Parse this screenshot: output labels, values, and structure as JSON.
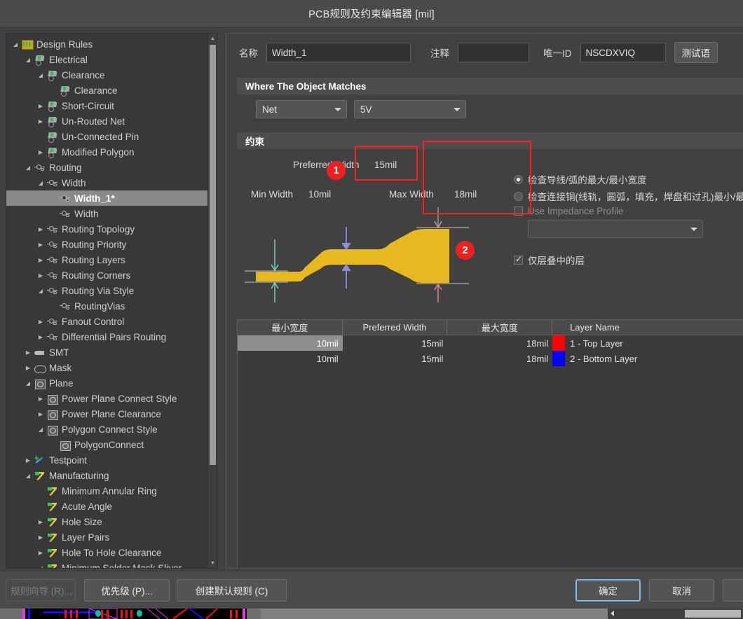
{
  "window": {
    "title": "PCB规则及约束编辑器 [mil]"
  },
  "sidebar": {
    "items": [
      {
        "label": "Design Rules",
        "depth": 0,
        "arrow": "expanded",
        "icon": "folder"
      },
      {
        "label": "Electrical",
        "depth": 1,
        "arrow": "expanded",
        "icon": "elec"
      },
      {
        "label": "Clearance",
        "depth": 2,
        "arrow": "expanded",
        "icon": "elec"
      },
      {
        "label": "Clearance",
        "depth": 3,
        "arrow": "none",
        "icon": "elec"
      },
      {
        "label": "Short-Circuit",
        "depth": 2,
        "arrow": "collapsed",
        "icon": "elec"
      },
      {
        "label": "Un-Routed Net",
        "depth": 2,
        "arrow": "collapsed",
        "icon": "elec"
      },
      {
        "label": "Un-Connected Pin",
        "depth": 2,
        "arrow": "none",
        "icon": "elec"
      },
      {
        "label": "Modified Polygon",
        "depth": 2,
        "arrow": "collapsed",
        "icon": "elec"
      },
      {
        "label": "Routing",
        "depth": 1,
        "arrow": "expanded",
        "icon": "route"
      },
      {
        "label": "Width",
        "depth": 2,
        "arrow": "expanded",
        "icon": "route"
      },
      {
        "label": "Width_1*",
        "depth": 3,
        "arrow": "none",
        "icon": "route",
        "selected": true
      },
      {
        "label": "Width",
        "depth": 3,
        "arrow": "none",
        "icon": "route"
      },
      {
        "label": "Routing Topology",
        "depth": 2,
        "arrow": "collapsed",
        "icon": "route"
      },
      {
        "label": "Routing Priority",
        "depth": 2,
        "arrow": "collapsed",
        "icon": "route"
      },
      {
        "label": "Routing Layers",
        "depth": 2,
        "arrow": "collapsed",
        "icon": "route"
      },
      {
        "label": "Routing Corners",
        "depth": 2,
        "arrow": "collapsed",
        "icon": "route"
      },
      {
        "label": "Routing Via Style",
        "depth": 2,
        "arrow": "expanded",
        "icon": "route"
      },
      {
        "label": "RoutingVias",
        "depth": 3,
        "arrow": "none",
        "icon": "route"
      },
      {
        "label": "Fanout Control",
        "depth": 2,
        "arrow": "collapsed",
        "icon": "route"
      },
      {
        "label": "Differential Pairs Routing",
        "depth": 2,
        "arrow": "collapsed",
        "icon": "route"
      },
      {
        "label": "SMT",
        "depth": 1,
        "arrow": "collapsed",
        "icon": "smt"
      },
      {
        "label": "Mask",
        "depth": 1,
        "arrow": "collapsed",
        "icon": "mask"
      },
      {
        "label": "Plane",
        "depth": 1,
        "arrow": "expanded",
        "icon": "plane"
      },
      {
        "label": "Power Plane Connect Style",
        "depth": 2,
        "arrow": "collapsed",
        "icon": "plane"
      },
      {
        "label": "Power Plane Clearance",
        "depth": 2,
        "arrow": "collapsed",
        "icon": "plane"
      },
      {
        "label": "Polygon Connect Style",
        "depth": 2,
        "arrow": "expanded",
        "icon": "plane"
      },
      {
        "label": "PolygonConnect",
        "depth": 3,
        "arrow": "none",
        "icon": "plane"
      },
      {
        "label": "Testpoint",
        "depth": 1,
        "arrow": "collapsed",
        "icon": "test"
      },
      {
        "label": "Manufacturing",
        "depth": 1,
        "arrow": "expanded",
        "icon": "manu"
      },
      {
        "label": "Minimum Annular Ring",
        "depth": 2,
        "arrow": "none",
        "icon": "manu"
      },
      {
        "label": "Acute Angle",
        "depth": 2,
        "arrow": "none",
        "icon": "manu"
      },
      {
        "label": "Hole Size",
        "depth": 2,
        "arrow": "collapsed",
        "icon": "manu"
      },
      {
        "label": "Layer Pairs",
        "depth": 2,
        "arrow": "collapsed",
        "icon": "manu"
      },
      {
        "label": "Hole To Hole Clearance",
        "depth": 2,
        "arrow": "collapsed",
        "icon": "manu"
      },
      {
        "label": "Minimum Solder Mask Sliver",
        "depth": 2,
        "arrow": "expanded",
        "icon": "manu"
      }
    ]
  },
  "form": {
    "name_label": "名称",
    "name_value": "Width_1",
    "comment_label": "注释",
    "comment_value": "",
    "uid_label": "唯一ID",
    "uid_value": "NSCDXVIQ",
    "test_button": "测试语"
  },
  "where_section": {
    "title": "Where The Object Matches",
    "scope_type": "Net",
    "scope_value": "5V"
  },
  "constraint_section": {
    "title": "约束",
    "preferred_width_label": "Preferred Width",
    "preferred_width_value": "15mil",
    "min_width_label": "Min Width",
    "min_width_value": "10mil",
    "max_width_label": "Max Width",
    "max_width_value": "18mil",
    "radio_check_track": "检查导线/弧的最大/最小宽度",
    "radio_check_copper": "检查连接铜(线轨，圆弧，填充，焊盘和过孔)最小/最",
    "use_impedance_profile": "Use Impedance Profile",
    "impedance_profile_value": "",
    "layers_in_stack_only": "仅层叠中的层"
  },
  "table": {
    "columns": [
      "最小宽度",
      "Preferred Width",
      "最大宽度",
      "Layer Name"
    ],
    "rows": [
      {
        "min": "10mil",
        "preferred": "15mil",
        "max": "18mil",
        "color": "#ff0000",
        "layer": "1 - Top Layer",
        "selected": true
      },
      {
        "min": "10mil",
        "preferred": "15mil",
        "max": "18mil",
        "color": "#0000ff",
        "layer": "2 - Bottom Layer",
        "selected": false
      }
    ]
  },
  "annotations": [
    {
      "id": "1",
      "label": "1"
    },
    {
      "id": "2",
      "label": "2"
    }
  ],
  "footer": {
    "rule_wizard": "规则向导 (R)...",
    "priority": "优先级 (P)...",
    "create_default": "创建默认规则 (C)",
    "ok": "确定",
    "cancel": "取消"
  },
  "colors": {
    "accent_red": "#f02020",
    "trace_gold": "#e8b820",
    "top_layer": "#ff0000",
    "bottom_layer": "#0000ff",
    "primary_border": "#7fb8e8"
  }
}
